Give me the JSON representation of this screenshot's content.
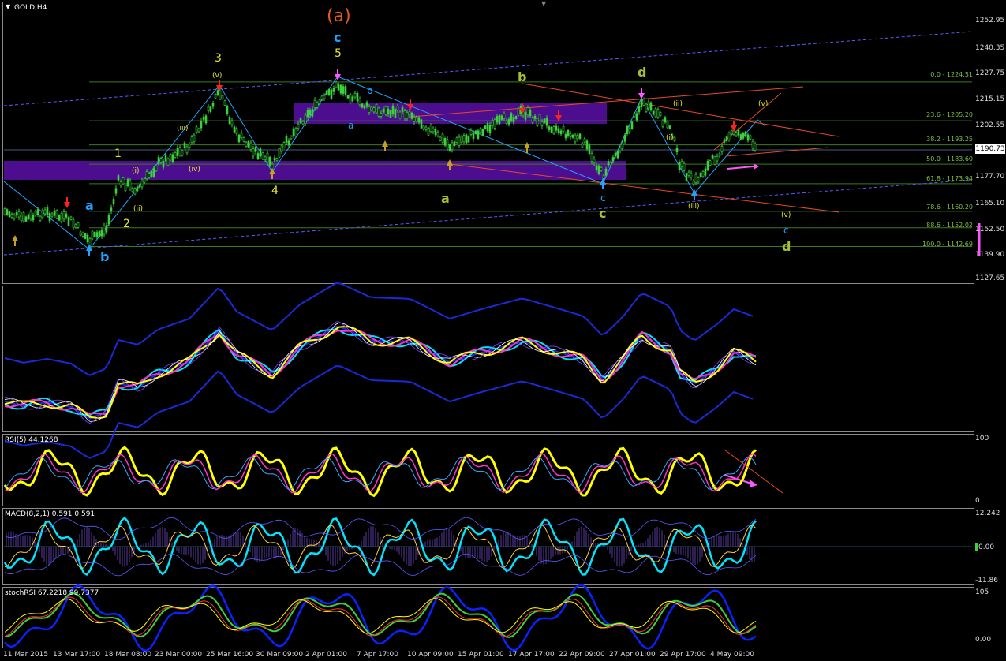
{
  "colors": {
    "bg": "#000000",
    "candle": "#3cd23c",
    "purple_zone": "#5a0fa8",
    "fib_line": "#3b7a1e",
    "channel": "#5a5aff",
    "wave_orange": "#e35a1e",
    "wave_cyan": "#1fa3ff",
    "wave_yellow": "#e6e630",
    "wave_green": "#a8c030",
    "rsi_line": "#ffff00",
    "macd_line": "#00e5ff",
    "accent_pink": "#ff55ff"
  },
  "main": {
    "symbol_title": "GOLD,H4",
    "current_price": "1190.73",
    "price_axis": [
      "1252.95",
      "1240.35",
      "1227.75",
      "1215.15",
      "1202.55",
      "1177.70",
      "1165.10",
      "1152.50",
      "1139.90",
      "1127.65"
    ],
    "fib_levels": [
      {
        "label": "0.0 - 1224.51",
        "value": 1224.51
      },
      {
        "label": "23.6 - 1205.20",
        "value": 1205.2
      },
      {
        "label": "38.2 - 1193.25",
        "value": 1193.25
      },
      {
        "label": "50.0 - 1183.60",
        "value": 1183.6
      },
      {
        "label": "61.8 - 1173.94",
        "value": 1173.94
      },
      {
        "label": "78.6 - 1160.20",
        "value": 1160.2
      },
      {
        "label": "88.6 - 1152.02",
        "value": 1152.02
      },
      {
        "label": "100.0 - 1142.69",
        "value": 1142.69
      }
    ],
    "wave_labels": {
      "big_a": "(a)",
      "c_top": "c",
      "five": "5",
      "three": "3",
      "four": "4",
      "one": "1",
      "two": "2",
      "a_left": "a",
      "b_left": "b",
      "v_small": "(v)",
      "iii_small": "(iii)",
      "iv_small": "(iv)",
      "i_small": "(i)",
      "ii_small": "(ii)",
      "a_mid": "a",
      "b_mid": "b",
      "c_mid": "c",
      "d_right": "d",
      "b_green": "b",
      "a_green": "a",
      "c_green": "c",
      "iii_right": "(iii)",
      "i_right": "(i)",
      "ii_right": "(ii)",
      "v_right": "(v)",
      "v_future": "(v)",
      "c_future": "c",
      "d_future": "d"
    }
  },
  "indicators": {
    "bands_title": "",
    "rsi_title": "RSI(5) 44.1268",
    "rsi_axis": [
      "100",
      "0"
    ],
    "macd_title": "MACD(8,2,1) 0.591 0.591",
    "macd_axis": [
      "12.242",
      "0.00",
      "-11.86"
    ],
    "stoch_title": "stochRSI 67.2218 99.7377",
    "stoch_axis": [
      "105",
      "0.00"
    ]
  },
  "time_axis": [
    "11 Mar 2015",
    "13 Mar 17:00",
    "18 Mar 08:00",
    "23 Mar 00:00",
    "25 Mar 16:00",
    "30 Mar 09:00",
    "2 Apr 01:00",
    "7 Apr 17:00",
    "10 Apr 09:00",
    "15 Apr 01:00",
    "17 Apr 17:00",
    "22 Apr 09:00",
    "27 Apr 01:00",
    "29 Apr 17:00",
    "4 May 09:00"
  ]
}
